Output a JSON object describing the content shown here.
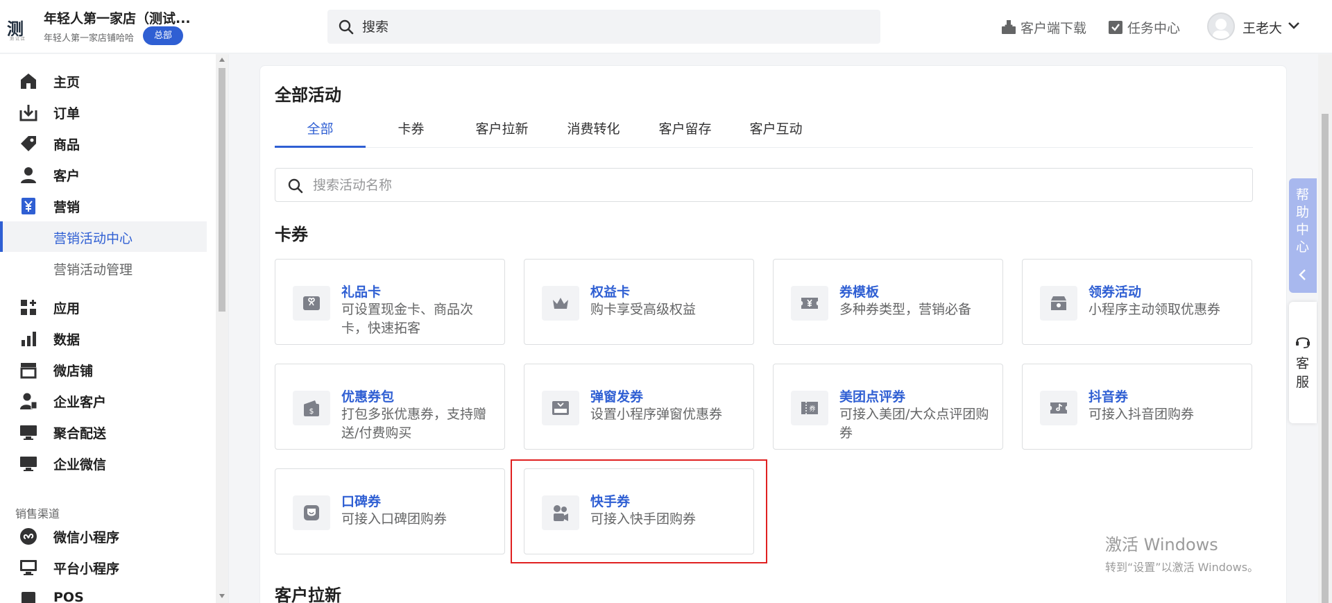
{
  "header": {
    "logo_text": "测",
    "logo_sub": "测 试 店",
    "shop_name": "年轻人第一家店（测试...",
    "shop_subtitle": "年轻人第一家店铺哈哈",
    "badge": "总部",
    "search_placeholder": "搜索",
    "client_download": "客户端下载",
    "task_center": "任务中心",
    "user_name": "王老大"
  },
  "sidebar": {
    "items": [
      {
        "label": "主页",
        "icon": "home-icon"
      },
      {
        "label": "订单",
        "icon": "order-icon"
      },
      {
        "label": "商品",
        "icon": "tag-icon"
      },
      {
        "label": "客户",
        "icon": "user-icon"
      },
      {
        "label": "营销",
        "icon": "yuan-icon"
      }
    ],
    "sub_items": [
      {
        "label": "营销活动中心",
        "active": true
      },
      {
        "label": "营销活动管理",
        "active": false
      }
    ],
    "items2": [
      {
        "label": "应用",
        "icon": "apps-icon"
      },
      {
        "label": "数据",
        "icon": "chart-icon"
      },
      {
        "label": "微店铺",
        "icon": "store-icon"
      },
      {
        "label": "企业客户",
        "icon": "enterprise-user-icon"
      },
      {
        "label": "聚合配送",
        "icon": "monitor-icon"
      },
      {
        "label": "企业微信",
        "icon": "desktop-icon"
      }
    ],
    "channel_label": "销售渠道",
    "channels": [
      {
        "label": "微信小程序",
        "icon": "mini-program-icon"
      },
      {
        "label": "平台小程序",
        "icon": "platform-icon"
      },
      {
        "label": "POS",
        "icon": "pos-icon"
      }
    ]
  },
  "main": {
    "title": "全部活动",
    "tabs": [
      {
        "label": "全部",
        "active": true
      },
      {
        "label": "卡券",
        "active": false
      },
      {
        "label": "客户拉新",
        "active": false
      },
      {
        "label": "消费转化",
        "active": false
      },
      {
        "label": "客户留存",
        "active": false
      },
      {
        "label": "客户互动",
        "active": false
      }
    ],
    "search_placeholder": "搜索活动名称",
    "section_cards": "卡券",
    "cards": [
      {
        "title": "礼品卡",
        "desc": "可设置现金卡、商品次卡，快速拓客",
        "icon": "gift-card-icon"
      },
      {
        "title": "权益卡",
        "desc": "购卡享受高级权益",
        "icon": "crown-icon"
      },
      {
        "title": "券模板",
        "desc": "多种券类型，营销必备",
        "icon": "coupon-template-icon"
      },
      {
        "title": "领券活动",
        "desc": "小程序主动领取优惠券",
        "icon": "coupon-claim-icon"
      },
      {
        "title": "优惠券包",
        "desc": "打包多张优惠券，支持赠送/付费购买",
        "icon": "coupon-pack-icon"
      },
      {
        "title": "弹窗发券",
        "desc": "设置小程序弹窗优惠券",
        "icon": "popup-coupon-icon"
      },
      {
        "title": "美团点评券",
        "desc": "可接入美团/大众点评团购券",
        "icon": "meituan-coupon-icon"
      },
      {
        "title": "抖音券",
        "desc": "可接入抖音团购券",
        "icon": "douyin-coupon-icon"
      },
      {
        "title": "口碑券",
        "desc": "可接入口碑团购券",
        "icon": "koubei-coupon-icon"
      },
      {
        "title": "快手券",
        "desc": "可接入快手团购券",
        "icon": "kuaishou-coupon-icon"
      }
    ],
    "section_next": "客户拉新"
  },
  "right": {
    "help": "帮助中心",
    "service": "客服"
  },
  "watermark": {
    "line1": "激活 Windows",
    "line2": "转到“设置”以激活 Windows。"
  },
  "colors": {
    "accent": "#2f5fd3",
    "highlight": "#e02020"
  }
}
